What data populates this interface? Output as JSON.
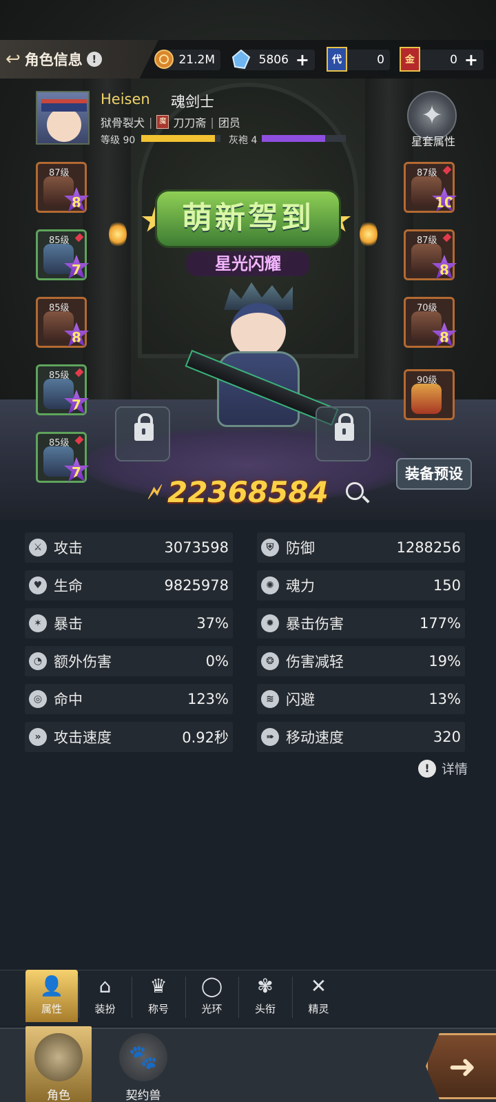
{
  "header": {
    "title": "角色信息",
    "currencies": [
      {
        "icon": "gold-coin-icon",
        "value": "21.2M",
        "has_plus": false
      },
      {
        "icon": "crystal-icon",
        "value": "5806",
        "has_plus": true
      },
      {
        "icon": "blue-card-icon",
        "icon_text": "代",
        "value": "0",
        "has_plus": false
      },
      {
        "icon": "red-card-icon",
        "icon_text": "金",
        "value": "0",
        "has_plus": true
      }
    ]
  },
  "player": {
    "name": "Heisen",
    "class": "魂剑士",
    "title": "狱骨裂犬",
    "guild_icon_text": "魔",
    "guild": "刀刀斋",
    "role": "团员",
    "level_label": "等级 90",
    "level_progress": 0.93,
    "rank_label": "灰袍 4",
    "rank_progress": 0.75,
    "star_set_label": "星套属性"
  },
  "equipment": {
    "left": [
      {
        "level": "87级",
        "rank": "8",
        "quality": "orange",
        "gem": false
      },
      {
        "level": "85级",
        "rank": "7",
        "quality": "green",
        "gem": true
      },
      {
        "level": "85级",
        "rank": "8",
        "quality": "orange",
        "gem": false
      },
      {
        "level": "85级",
        "rank": "7",
        "quality": "green",
        "gem": true
      },
      {
        "level": "85级",
        "rank": "7",
        "quality": "green",
        "gem": true
      }
    ],
    "right": [
      {
        "level": "87级",
        "rank": "10",
        "quality": "orange",
        "gem": true
      },
      {
        "level": "87级",
        "rank": "8",
        "quality": "orange",
        "gem": true
      },
      {
        "level": "70级",
        "rank": "8",
        "quality": "orange",
        "gem": false
      }
    ],
    "special": {
      "level": "90级"
    }
  },
  "scene": {
    "banner": "萌新驾到",
    "subtitle": "星光闪耀",
    "preset_button": "装备预设"
  },
  "power": {
    "value": "22368584"
  },
  "stats": [
    {
      "icon": "attack-icon",
      "label": "攻击",
      "value": "3073598"
    },
    {
      "icon": "defense-icon",
      "label": "防御",
      "value": "1288256"
    },
    {
      "icon": "hp-icon",
      "label": "生命",
      "value": "9825978"
    },
    {
      "icon": "soul-icon",
      "label": "魂力",
      "value": "150"
    },
    {
      "icon": "crit-icon",
      "label": "暴击",
      "value": "37%"
    },
    {
      "icon": "crit-damage-icon",
      "label": "暴击伤害",
      "value": "177%"
    },
    {
      "icon": "extra-damage-icon",
      "label": "额外伤害",
      "value": "0%"
    },
    {
      "icon": "damage-reduce-icon",
      "label": "伤害减轻",
      "value": "19%"
    },
    {
      "icon": "accuracy-icon",
      "label": "命中",
      "value": "123%"
    },
    {
      "icon": "dodge-icon",
      "label": "闪避",
      "value": "13%"
    },
    {
      "icon": "attack-speed-icon",
      "label": "攻击速度",
      "value": "0.92秒"
    },
    {
      "icon": "move-speed-icon",
      "label": "移动速度",
      "value": "320"
    }
  ],
  "detail_label": "详情",
  "tabs": [
    {
      "icon": "person-icon",
      "label": "属性",
      "active": true
    },
    {
      "icon": "hanger-icon",
      "label": "装扮",
      "active": false
    },
    {
      "icon": "crown-icon",
      "label": "称号",
      "active": false
    },
    {
      "icon": "halo-icon",
      "label": "光环",
      "active": false
    },
    {
      "icon": "headgear-icon",
      "label": "头衔",
      "active": false
    },
    {
      "icon": "spirit-icon",
      "label": "精灵",
      "active": false
    }
  ],
  "bottom_nav": [
    {
      "icon": "character-icon",
      "label": "角色",
      "active": true
    },
    {
      "icon": "paw-icon",
      "label": "契约兽",
      "active": false
    }
  ],
  "colors": {
    "level_bar": "#f2c232",
    "rank_bar": "#8e4fe0",
    "power_text": "#fbd247",
    "name": "#f2d36b"
  }
}
